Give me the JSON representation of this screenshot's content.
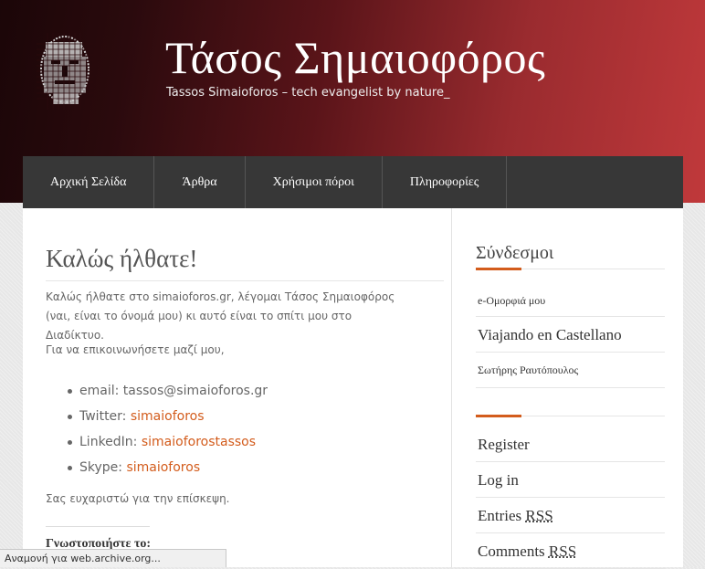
{
  "header": {
    "title": "Τάσος Σημαιοφόρος",
    "tagline": "Tassos Simaioforos – tech evangelist by nature_",
    "logo_icon": "pixel-portrait-logo-icon"
  },
  "nav": {
    "items": [
      {
        "label": "Αρχική Σελίδα"
      },
      {
        "label": "Άρθρα"
      },
      {
        "label": "Χρήσιμοι πόροι"
      },
      {
        "label": "Πληροφορίες"
      }
    ]
  },
  "main": {
    "title": "Καλώς ήλθατε!",
    "intro": "Καλώς ήλθατε στο simaioforos.gr, λέγομαι Τάσος Σημαιοφόρος (ναι, είναι το όνομά μου) κι αυτό είναι το σπίτι μου στο Διαδίκτυο.",
    "contact_intro": "Για να επικοινωνήσετε μαζί μου,",
    "contacts": [
      {
        "label": "email: tassos@simaioforos.gr",
        "link": ""
      },
      {
        "label": "Twitter: ",
        "link": "simaioforos"
      },
      {
        "label": "LinkedIn: ",
        "link": "simaioforostassos"
      },
      {
        "label": "Skype: ",
        "link": "simaioforos"
      }
    ],
    "thanks": "Σας ευχαριστώ για την επίσκεψη.",
    "share_heading": "Γνωστοποιήστε το:"
  },
  "sidebar": {
    "links_title": "Σύνδεσμοι",
    "links": [
      {
        "label": "e-Ομορφιά μου"
      },
      {
        "label": "Viajando en Castellano"
      },
      {
        "label": "Σωτήρης Ραυτόπουλος"
      }
    ],
    "meta": {
      "register": "Register",
      "login": "Log in",
      "entries": "Entries ",
      "comments": "Comments ",
      "rss": "RSS"
    }
  },
  "status_bar": {
    "text": "Αναμονή για web.archive.org..."
  },
  "colors": {
    "accent": "#d35c1c",
    "nav_bg": "#373737",
    "header_dark": "#1b0608",
    "header_red": "#c0393b"
  }
}
